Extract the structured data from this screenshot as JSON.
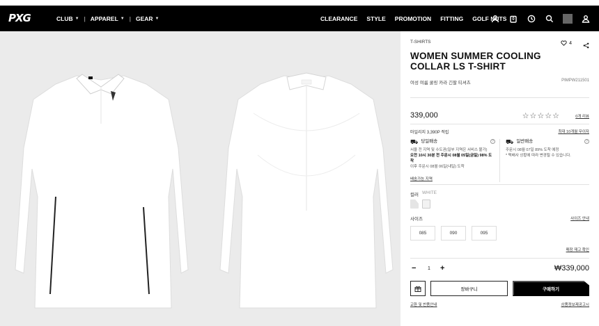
{
  "brand": {
    "logo_text": "PXG"
  },
  "nav": {
    "left": [
      {
        "label": "CLUB"
      },
      {
        "label": "APPAREL"
      },
      {
        "label": "GEAR"
      }
    ],
    "right": [
      "CLEARANCE",
      "STYLE",
      "PROMOTION",
      "FITTING",
      "GOLF NUTS"
    ],
    "icons": [
      "user-icon",
      "cart-icon",
      "recent-icon",
      "search-icon",
      "account-icon"
    ],
    "cart_count": "0"
  },
  "product": {
    "category": "T-SHIRTS",
    "title": "WOMEN SUMMER COOLING COLLAR LS T-SHIRT",
    "subtitle_kr": "여성 여름 쿨링 카라 긴팔 티셔츠",
    "code": "PIMPW211501",
    "wish_count": "4",
    "price": "339,000",
    "stars": "☆☆☆☆☆",
    "review_link": "0개 리뷰",
    "points_text": "마일리지 3,390P 적립",
    "points_link": "최대 10개월 무이자",
    "delivery": {
      "today": {
        "title": "당일배송",
        "line1": "서울 전 지역 및 수도권(일부 지역은 서비스 불가)",
        "line2": "오전 10시 30분 전 주문시 08월 05일(금일) 98% 도착",
        "line3": "이후 주문시 08월 06일(내일) 도착"
      },
      "normal": {
        "title": "일반배송",
        "line1": "주문시 08월 07일 89% 도착 예정",
        "line2": "* 택배사 상황에 따라 변경될 수 있습니다."
      }
    },
    "store_link": "배송가능 지역",
    "color_label": "컬러",
    "color_value": "WHITE",
    "size_label": "사이즈",
    "size_guide": "사이즈 안내",
    "sizes": [
      "085",
      "090",
      "095"
    ],
    "stock_link": "매장 재고 확인",
    "qty_minus": "−",
    "qty": "1",
    "qty_plus": "+",
    "total": "₩339,000",
    "cart_button": "장바구니",
    "buy_button": "구매하기",
    "return_link": "교환 및 반품안내",
    "info_link": "상품정보제공고시"
  }
}
